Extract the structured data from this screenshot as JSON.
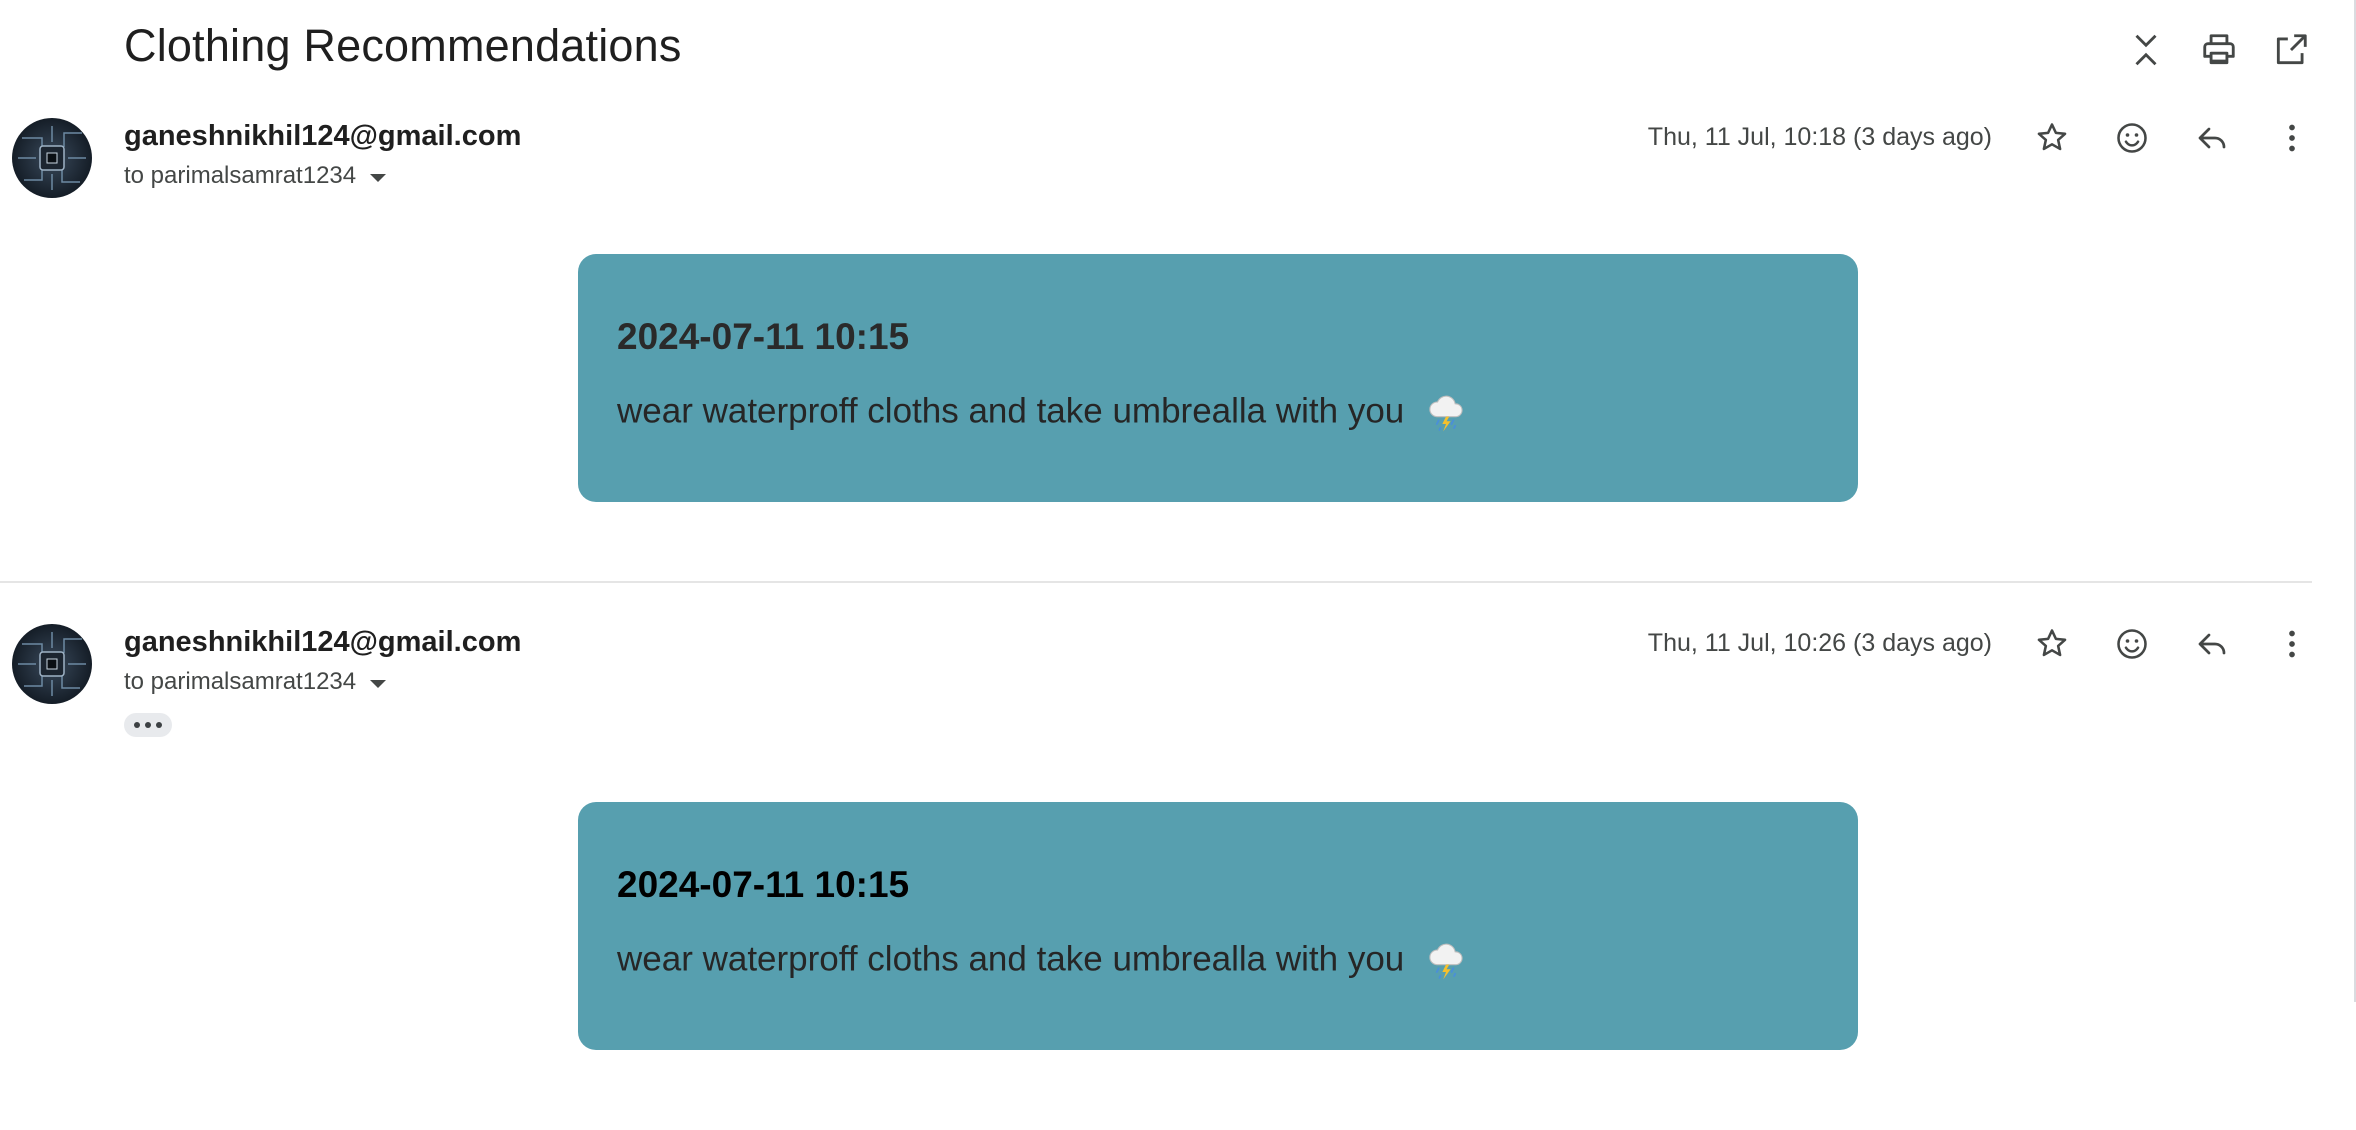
{
  "thread": {
    "subject": "Clothing Recommendations"
  },
  "header_icons": [
    "collapse-all-icon",
    "print-icon",
    "open-in-new-window-icon"
  ],
  "messages": [
    {
      "sender": "ganeshnikhil124@gmail.com",
      "to": "to parimalsamrat1234",
      "date": "Thu, 11 Jul, 10:18 (3 days ago)",
      "card": {
        "title": "2024-07-11 10:15",
        "text": "wear waterproff cloths and take umbrealla with you"
      }
    },
    {
      "sender": "ganeshnikhil124@gmail.com",
      "to": "to parimalsamrat1234",
      "date": "Thu, 11 Jul, 10:26 (3 days ago)",
      "card": {
        "title": "2024-07-11 10:15",
        "text": "wear waterproff cloths and take umbrealla with you"
      }
    }
  ],
  "colors": {
    "card_background": "#579faf",
    "text_primary": "#1f1f1f",
    "text_secondary": "#444746"
  }
}
